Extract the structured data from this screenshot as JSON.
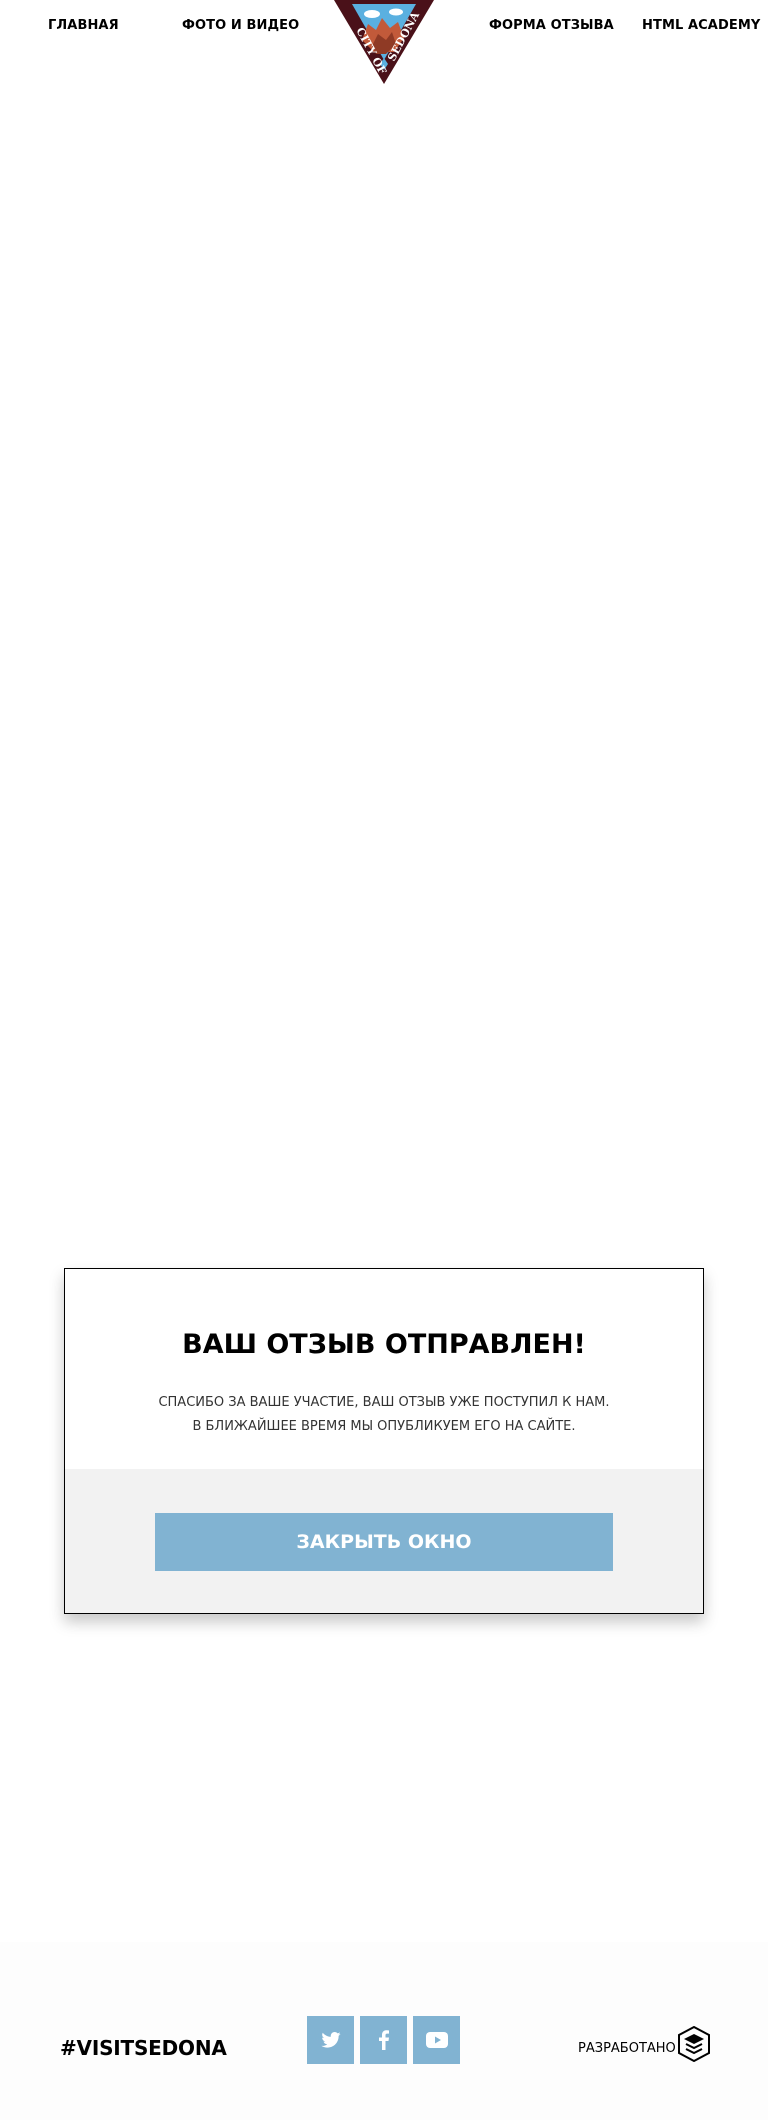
{
  "nav": {
    "items": [
      {
        "label": "ГЛАВНАЯ"
      },
      {
        "label": "ФОТО И ВИДЕО"
      },
      {
        "label": "ФОРМА ОТЗЫВА"
      },
      {
        "label": "HTML ACADEMY"
      }
    ]
  },
  "logo": {
    "text": "CITY OF SEDONA",
    "icon": "sedona-logo-icon",
    "colors": {
      "dark": "#4a1119",
      "sky": "#5ab0e0",
      "rock": "#c25a3a"
    }
  },
  "modal": {
    "title": "ВАШ ОТЗЫВ ОТПРАВЛЕН!",
    "line1": "СПАСИБО ЗА ВАШЕ УЧАСТИЕ, ВАШ ОТЗЫВ УЖЕ ПОСТУПИЛ К НАМ.",
    "line2": "В БЛИЖАЙШЕЕ ВРЕМЯ МЫ ОПУБЛИКУЕМ ЕГО НА САЙТЕ.",
    "close_label": "ЗАКРЫТЬ ОКНО"
  },
  "footer": {
    "hashtag": "#VISITSEDONA",
    "social": [
      {
        "icon": "twitter-icon"
      },
      {
        "icon": "facebook-icon"
      },
      {
        "icon": "youtube-icon"
      }
    ],
    "dev_label": "РАЗРАБОТАНО",
    "dev_icon": "html-academy-icon"
  },
  "colors": {
    "accent": "#81b3d2",
    "modal_bottom": "#f2f2f2"
  }
}
